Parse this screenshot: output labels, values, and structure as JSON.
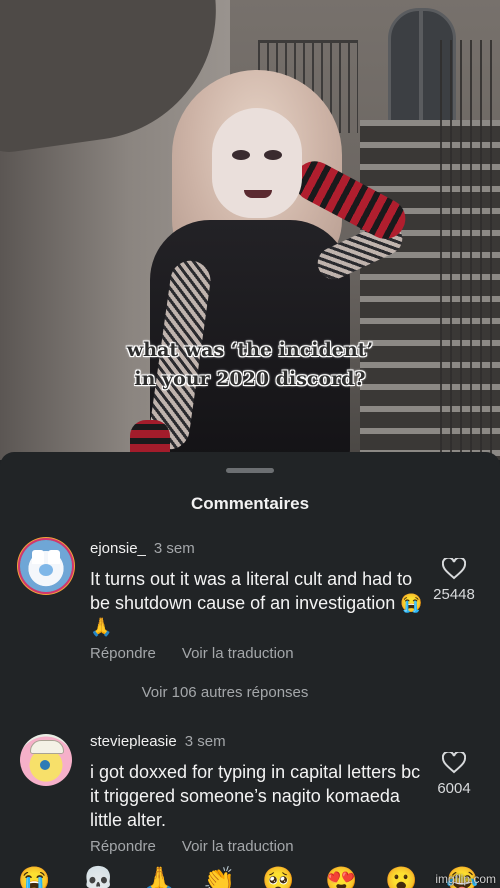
{
  "video": {
    "caption_line1": "what was ‘the incident’",
    "caption_line2": "in your 2020 discord?"
  },
  "sheet": {
    "title": "Commentaires",
    "comments": [
      {
        "username": "ejonsie_",
        "time": "3 sem",
        "text": "It turns out it was a literal cult and had to be shutdown cause of an investigation 😭🙏",
        "like_count": "25448",
        "reply_label": "Répondre",
        "translate_label": "Voir la traduction",
        "more_replies": "Voir 106 autres réponses"
      },
      {
        "username": "steviepleasie",
        "time": "3 sem",
        "text": "i got doxxed for typing in capital letters bc it triggered someone’s nagito komaeda little alter.",
        "like_count": "6004",
        "reply_label": "Répondre",
        "translate_label": "Voir la traduction"
      }
    ]
  },
  "emoji_bar": [
    "😭",
    "💀",
    "🙏",
    "👏",
    "🥺",
    "😍",
    "😮",
    "😂"
  ],
  "watermark": "imgflip.com",
  "colors": {
    "sheet_bg": "#212426",
    "text": "#f3f3f3",
    "muted": "#a4a7aa",
    "story_ring": "#d1366f"
  },
  "icons": {
    "like": "heart-outline-icon"
  }
}
